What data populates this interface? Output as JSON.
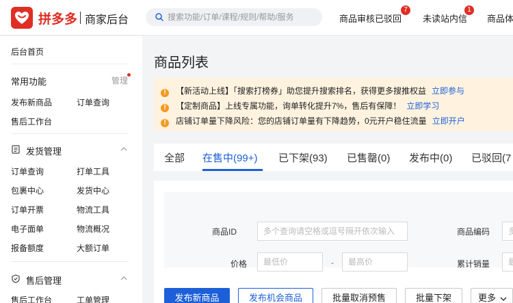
{
  "header": {
    "brand": "拼多多",
    "sub": "商家后台",
    "search_placeholder": "搜索功能/订单/课程/规则/帮助/服务",
    "nav": [
      {
        "label": "商品审核已驳回",
        "badge": "7"
      },
      {
        "label": "未读站内信",
        "badge": "1"
      },
      {
        "label": "商品体"
      }
    ]
  },
  "sidebar": {
    "home": "后台首页",
    "common": {
      "title": "常用功能",
      "manage": "管理",
      "items": [
        "发布新商品",
        "订单查询",
        "售后工作台"
      ]
    },
    "shipping": {
      "title": "发货管理",
      "items": [
        "订单查询",
        "打单工具",
        "包裹中心",
        "发货中心",
        "订单开票",
        "物流工具",
        "电子面单",
        "物流概况",
        "报备额度",
        "大额订单"
      ]
    },
    "aftersale": {
      "title": "售后管理",
      "items": [
        "售后工作台",
        "工单管理"
      ]
    }
  },
  "main": {
    "title": "商品列表",
    "notices": [
      {
        "text": "【新活动上线】「搜索打榜券」助您提升搜索排名，获得更多搜推权益",
        "link": "立即参与"
      },
      {
        "text": "【定制商品】上线专属功能，询单转化提升7%，售后有保障！",
        "link": "立即学习"
      },
      {
        "text": "店铺订单量下降风险：您的店铺订单量有下降趋势，0元开户稳住流量",
        "link": "立即开户"
      }
    ],
    "tabs": [
      "全部",
      "在售中(99+)",
      "已下架(93)",
      "已售罄(0)",
      "发布中(0)",
      "已驳回(7"
    ],
    "filters": {
      "id_label": "商品ID",
      "id_placeholder": "多个查询请空格或逗号隔开依次输入",
      "code_label": "商品编码",
      "code_placeholder": "多",
      "price_label": "价格",
      "price_min": "最低价",
      "price_sep": "-",
      "price_max": "最高价",
      "sales_label": "累计销量",
      "sales_placeholder": "最"
    },
    "buttons": [
      "发布新商品",
      "发布机会商品",
      "批量取消预售",
      "批量下架",
      "更多"
    ]
  },
  "colors": {
    "brand": "#e02e24",
    "accent": "#1c5fd8",
    "warning": "#f59a23"
  }
}
